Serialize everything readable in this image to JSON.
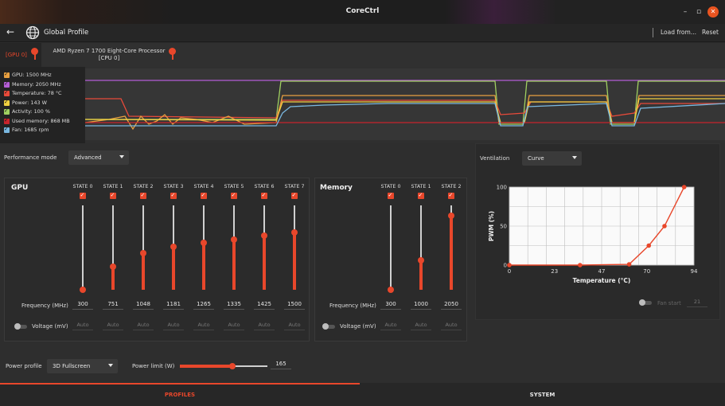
{
  "window": {
    "title": "CoreCtrl"
  },
  "header": {
    "profile_name": "Global Profile",
    "load_from": "Load from...",
    "reset": "Reset"
  },
  "device_tabs": [
    {
      "label": "[GPU 0]"
    },
    {
      "label_line1": "AMD Ryzen 7 1700 Eight-Core Processor",
      "label_line2": "[CPU 0]"
    }
  ],
  "legend": [
    {
      "label": "GPU: 1500 MHz",
      "color": "#e8a040"
    },
    {
      "label": "Memory: 2050 MHz",
      "color": "#b45ed6"
    },
    {
      "label": "Temperature: 78 °C",
      "color": "#e84a3a"
    },
    {
      "label": "Power: 143 W",
      "color": "#f0d040"
    },
    {
      "label": "Activity: 100 %",
      "color": "#a0d060"
    },
    {
      "label": "Used memory: 868 MB",
      "color": "#c8242c"
    },
    {
      "label": "Fan: 1685 rpm",
      "color": "#7ab8e0"
    }
  ],
  "perf": {
    "label": "Performance mode",
    "value": "Advanced"
  },
  "gpu_panel": {
    "title": "GPU",
    "states": [
      "STATE 0",
      "STATE 1",
      "STATE 2",
      "STATE 3",
      "STATE 4",
      "STATE 5",
      "STATE 6",
      "STATE 7"
    ],
    "levels": [
      0.0,
      0.27,
      0.43,
      0.51,
      0.56,
      0.59,
      0.64,
      0.68
    ],
    "freq_label": "Frequency (MHz)",
    "freqs": [
      "300",
      "751",
      "1048",
      "1181",
      "1265",
      "1335",
      "1425",
      "1500"
    ],
    "voltage_label": "Voltage (mV)",
    "auto": "Auto"
  },
  "mem_panel": {
    "title": "Memory",
    "states": [
      "STATE 0",
      "STATE 1",
      "STATE 2"
    ],
    "levels": [
      0.0,
      0.35,
      0.88
    ],
    "freq_label": "Frequency (MHz)",
    "freqs": [
      "300",
      "1000",
      "2050"
    ],
    "voltage_label": "Voltage (mV)",
    "auto": "Auto"
  },
  "ventilation": {
    "label": "Ventilation",
    "value": "Curve",
    "fan_start_label": "Fan start",
    "fan_start_value": "21"
  },
  "chart_data": {
    "type": "line",
    "xlabel": "Temperature (°C)",
    "ylabel": "PWM (%)",
    "x_ticks": [
      0,
      23,
      47,
      70,
      94
    ],
    "y_ticks": [
      0,
      50,
      100
    ],
    "xlim": [
      0,
      94
    ],
    "ylim": [
      0,
      100
    ],
    "points": [
      [
        0,
        0
      ],
      [
        36,
        0
      ],
      [
        61,
        1
      ],
      [
        71,
        25
      ],
      [
        79,
        50
      ],
      [
        89,
        100
      ]
    ],
    "color": "#e8472b"
  },
  "power": {
    "profile_label": "Power profile",
    "profile_value": "3D Fullscreen",
    "limit_label": "Power limit (W)",
    "limit_value": "165",
    "limit_fraction": 0.6
  },
  "bottom_tabs": {
    "profiles": "PROFILES",
    "system": "SYSTEM"
  }
}
